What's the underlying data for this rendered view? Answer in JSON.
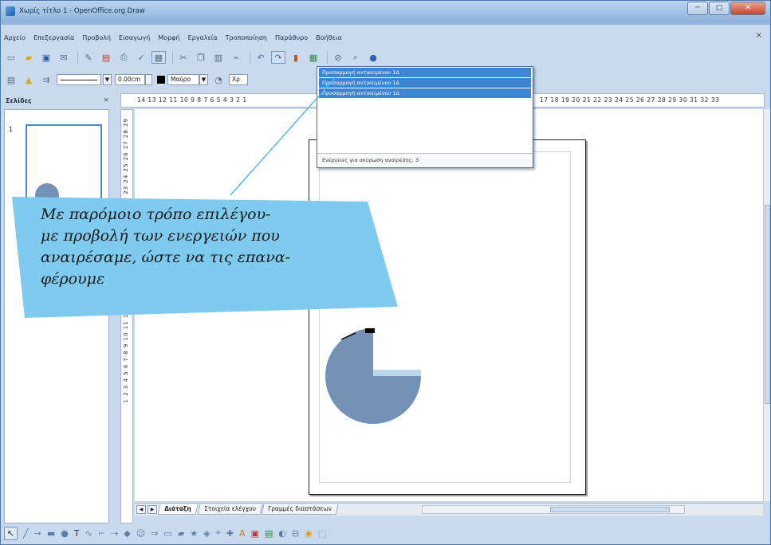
{
  "window": {
    "title": "Χωρίς τίτλο 1 - OpenOffice.org Draw",
    "minimize": "─",
    "maximize": "□",
    "close": "✕"
  },
  "menubar": {
    "items": [
      "Αρχείο",
      "Επεξεργασία",
      "Προβολή",
      "Εισαγωγή",
      "Μορφή",
      "Εργαλεία",
      "Τροποποίηση",
      "Παράθυρο",
      "Βοήθεια"
    ],
    "close": "×"
  },
  "toolbar2": {
    "line_width": "0.00cm",
    "color_name": "Μαύρο",
    "area_field": "Χρ"
  },
  "slides": {
    "title": "Σελίδες",
    "close": "×",
    "slide_number": "1"
  },
  "ruler": {
    "top_left": "14 13 12 11 10  9  8  7  6  5  4  3  2  1",
    "top_right": "17 18 19 20 21 22 23 24 25 26 27 28 29 30 31 32 33",
    "left": "1  2  3  4  5  6  7  8  9 10 11 12 13 14 15 16 17 18 19 20 21 22 23 24 25 26 27 28 29"
  },
  "redo_dropdown": {
    "items": [
      "Προσαρμογή αντικειμένου 1Δ",
      "Προσαρμογή αντικειμένου 1Δ",
      "Προσαρμογή αντικειμένου 1Δ"
    ],
    "footer": "Ενέργειες για ακύρωση αναίρεσης: 3"
  },
  "tabs": {
    "items": [
      "Διάταξη",
      "Στοιχεία ελέγχου",
      "Γραμμές διαστάσεων"
    ]
  },
  "callout": {
    "text_line1": "Με παρόμοιο τρόπο επιλέγου-",
    "text_line2": "με προβολή των ενεργειών που",
    "text_line3": "αναιρέσαμε, ώστε να τις επανα-",
    "text_line4": "φέρουμε"
  },
  "colors": {
    "pie_fill": "#7392b5",
    "pie_highlight": "#bcd6ea",
    "callout_fill": "#7fcbef",
    "selection": "#3d84d2"
  }
}
